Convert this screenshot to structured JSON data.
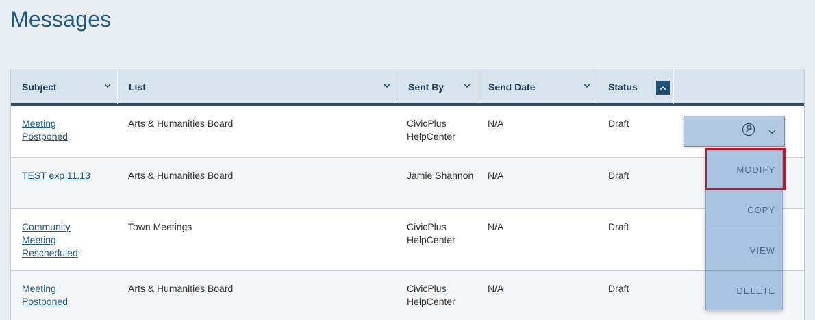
{
  "page": {
    "title": "Messages"
  },
  "table": {
    "columns": [
      {
        "label": "Subject"
      },
      {
        "label": "List"
      },
      {
        "label": "Sent By"
      },
      {
        "label": "Send Date"
      },
      {
        "label": "Status"
      }
    ],
    "sort_icon": "chevron-up-icon",
    "rows": [
      {
        "subject": "Meeting Postponed",
        "list": "Arts & Humanities Board",
        "sent_by": "CivicPlus HelpCenter",
        "send_date": "N/A",
        "status": "Draft"
      },
      {
        "subject": "TEST exp 11.13",
        "list": "Arts & Humanities Board",
        "sent_by": "Jamie Shannon",
        "send_date": "N/A",
        "status": "Draft"
      },
      {
        "subject": "Community Meeting Rescheduled",
        "list": "Town Meetings",
        "sent_by": "CivicPlus HelpCenter",
        "send_date": "N/A",
        "status": "Draft"
      },
      {
        "subject": "Meeting Postponed",
        "list": "Arts & Humanities Board",
        "sent_by": "CivicPlus HelpCenter",
        "send_date": "N/A",
        "status": "Draft"
      }
    ]
  },
  "actions": {
    "button_icon": "wrench-icon",
    "menu": [
      {
        "label": "MODIFY"
      },
      {
        "label": "COPY"
      },
      {
        "label": "VIEW"
      },
      {
        "label": "DELETE"
      }
    ],
    "highlighted_item": "MODIFY"
  },
  "colors": {
    "title": "#1e5a8a",
    "header_bg": "#d7e3ef",
    "header_border": "#1e4e79",
    "dropdown_bg": "#a9c4e0",
    "highlight": "#c0152d"
  }
}
